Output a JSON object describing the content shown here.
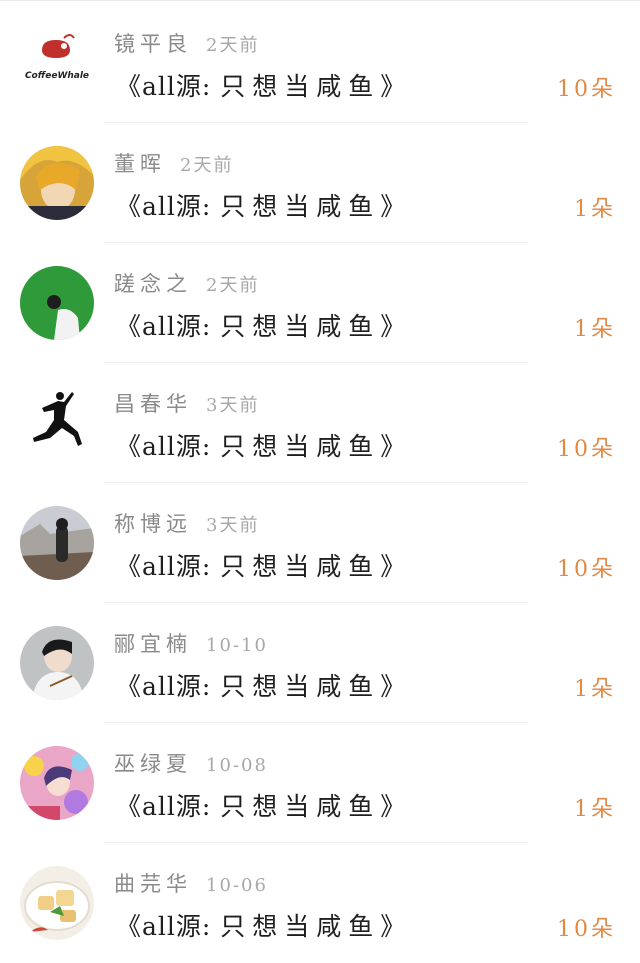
{
  "items": [
    {
      "name": "镜平良",
      "time": "2天前",
      "title_open": "《all源:",
      "title_main": "只想当咸鱼",
      "title_close": "》",
      "count": "10朵",
      "avatar": "coffee-whale-logo",
      "avatar_text": "CoffeeWhale"
    },
    {
      "name": "董晖",
      "time": "2天前",
      "title_open": "《all源:",
      "title_main": "只想当咸鱼",
      "title_close": "》",
      "count": "1朵",
      "avatar": "anime-blonde-boy-avatar"
    },
    {
      "name": "蹉念之",
      "time": "2天前",
      "title_open": "《all源:",
      "title_main": "只想当咸鱼",
      "title_close": "》",
      "count": "1朵",
      "avatar": "green-screen-person-avatar"
    },
    {
      "name": "昌春华",
      "time": "3天前",
      "title_open": "《all源:",
      "title_main": "只想当咸鱼",
      "title_close": "》",
      "count": "10朵",
      "avatar": "jumpman-logo"
    },
    {
      "name": "称博远",
      "time": "3天前",
      "title_open": "《all源:",
      "title_main": "只想当咸鱼",
      "title_close": "》",
      "count": "10朵",
      "avatar": "girl-snow-scene-avatar"
    },
    {
      "name": "郦宜楠",
      "time": "10-10",
      "title_open": "《all源:",
      "title_main": "只想当咸鱼",
      "title_close": "》",
      "count": "1朵",
      "avatar": "boy-black-hair-avatar"
    },
    {
      "name": "巫绿夏",
      "time": "10-08",
      "title_open": "《all源:",
      "title_main": "只想当咸鱼",
      "title_close": "》",
      "count": "1朵",
      "avatar": "colorful-anime-avatar"
    },
    {
      "name": "曲芫华",
      "time": "10-06",
      "title_open": "《all源:",
      "title_main": "只想当咸鱼",
      "title_close": "》",
      "count": "10朵",
      "avatar": "food-dish-avatar"
    }
  ],
  "colors": {
    "accent": "#e08a45",
    "name": "#8a8a8a",
    "time": "#a8a8a8",
    "title": "#1f1f1f",
    "divider": "#efefef"
  }
}
